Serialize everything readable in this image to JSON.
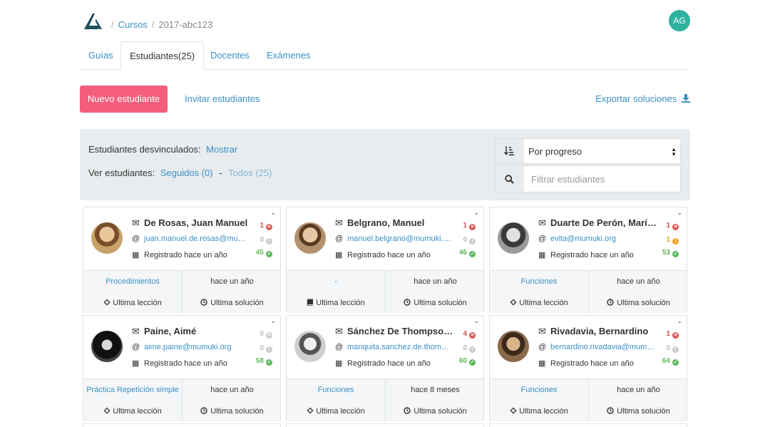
{
  "breadcrumb": {
    "courses": "Cursos",
    "current": "2017-abc123"
  },
  "user": {
    "initials": "AG"
  },
  "tabs": [
    {
      "label": "Guías"
    },
    {
      "label": "Estudiantes(25)"
    },
    {
      "label": "Docentes"
    },
    {
      "label": "Exámenes"
    }
  ],
  "actions": {
    "new_student": "Nuevo estudiante",
    "invite": "Invitar estudiantes",
    "export": "Exportar soluciones"
  },
  "filters": {
    "unlinked_label": "Estudiantes desvinculados:",
    "unlinked_action": "Mostrar",
    "view_label": "Ver estudiantes:",
    "followed": "Seguidos (0)",
    "dash": "-",
    "all": "Todos (25)",
    "sort_value": "Por progreso",
    "search_placeholder": "Filtrar estudiantes"
  },
  "labels": {
    "registered": "Registrado hace un año",
    "last_lesson": "Ultima lección",
    "last_solution": "Ultima solución"
  },
  "colors": {
    "accent": "#3a8fc5",
    "primary_button": "#f45e7b",
    "avatar": "#2db39e",
    "failed": "#d9534f",
    "warning": "#f0a020",
    "passed": "#5cb85c"
  },
  "students": [
    {
      "name": "De Rosas, Juan Manuel",
      "email": "juan.manuel.de.rosas@mumuki.org",
      "failed": "1",
      "warnings": "0",
      "passed": "45",
      "warn_color": "gray",
      "lesson": "Procedimientos",
      "last_time": "hace un año",
      "lesson_icon": "puzzle-icon"
    },
    {
      "name": "Belgrano, Manuel",
      "email": "manuel.belgrano@mumuki.org",
      "failed": "1",
      "warnings": "0",
      "passed": "46",
      "warn_color": "gray",
      "lesson": "-",
      "last_time": "hace un año",
      "lesson_icon": "book-icon"
    },
    {
      "name": "Duarte De Perón, María Eva",
      "email": "evita@mumuki.org",
      "failed": "1",
      "warnings": "1",
      "passed": "53",
      "warn_color": "orange",
      "lesson": "Funciones",
      "last_time": "hace un año",
      "lesson_icon": "puzzle-icon"
    },
    {
      "name": "Paine, Aimé",
      "email": "aime.paine@mumuki.org",
      "failed": "0",
      "warnings": "0",
      "passed": "58",
      "warn_color": "gray",
      "lesson": "Práctica Repetición simple",
      "last_time": "hace un año",
      "lesson_icon": "puzzle-icon"
    },
    {
      "name": "Sánchez De Thompson, Mariquita",
      "email": "mariquita.sanchez.de.thompson@mumuki.org",
      "failed": "4",
      "warnings": "0",
      "passed": "60",
      "warn_color": "gray",
      "lesson": "Funciones",
      "last_time": "hace 8 meses",
      "lesson_icon": "puzzle-icon"
    },
    {
      "name": "Rivadavia, Bernardino",
      "email": "bernardino.rivadavia@mumuki.org",
      "failed": "1",
      "warnings": "0",
      "passed": "64",
      "warn_color": "gray",
      "lesson": "Funciones",
      "last_time": "hace un año",
      "lesson_icon": "puzzle-icon"
    }
  ]
}
